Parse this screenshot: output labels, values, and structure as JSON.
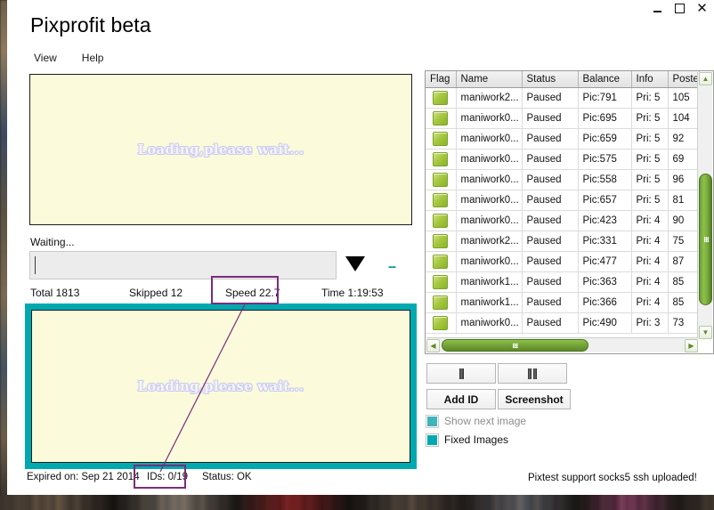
{
  "window": {
    "title": "Pixprofit beta",
    "controls": {
      "minimize": "–",
      "maximize": "□",
      "close": "✕"
    }
  },
  "menu": {
    "items": [
      {
        "label": "View"
      },
      {
        "label": "Help"
      }
    ]
  },
  "image_panels": {
    "primary": {
      "loading_text": "Loading,please wait..."
    },
    "secondary": {
      "loading_text": "Loading,please wait...",
      "border_color": "#00a9b0"
    }
  },
  "progress": {
    "status_label": "Waiting...",
    "value": "",
    "dropdown_icon": "triangle-down-icon",
    "dashes": "--"
  },
  "stats": {
    "total": "Total 1813",
    "skipped": "Skipped 12",
    "speed": "Speed 22.7",
    "time": "Time 1:19:53"
  },
  "bottom_status": {
    "expired": "Expired on: Sep 21 2014",
    "ids": "IDs: 0/19",
    "status": "Status: OK",
    "footer_note": "Pixtest support socks5  ssh uploaded!"
  },
  "annotations": {
    "color": "#7b2d7b",
    "highlight_speed": "Speed 22.7",
    "highlight_ids": "IDs: 0/19"
  },
  "table": {
    "columns": [
      "Flag",
      "Name",
      "Status",
      "Balance",
      "Info",
      "Poste"
    ],
    "rows": [
      {
        "flag": "flag-icon",
        "name": "maniwork2...",
        "status": "Paused",
        "balance": "Pic:791",
        "info": "Pri: 5",
        "posted": "105"
      },
      {
        "flag": "flag-icon",
        "name": "maniwork0...",
        "status": "Paused",
        "balance": "Pic:695",
        "info": "Pri: 5",
        "posted": "104"
      },
      {
        "flag": "flag-icon",
        "name": "maniwork0...",
        "status": "Paused",
        "balance": "Pic:659",
        "info": "Pri: 5",
        "posted": "92"
      },
      {
        "flag": "flag-icon",
        "name": "maniwork0...",
        "status": "Paused",
        "balance": "Pic:575",
        "info": "Pri: 5",
        "posted": "69"
      },
      {
        "flag": "flag-icon",
        "name": "maniwork0...",
        "status": "Paused",
        "balance": "Pic:558",
        "info": "Pri: 5",
        "posted": "96"
      },
      {
        "flag": "flag-icon",
        "name": "maniwork0...",
        "status": "Paused",
        "balance": "Pic:657",
        "info": "Pri: 5",
        "posted": "81"
      },
      {
        "flag": "flag-icon",
        "name": "maniwork0...",
        "status": "Paused",
        "balance": "Pic:423",
        "info": "Pri: 4",
        "posted": "90"
      },
      {
        "flag": "flag-icon",
        "name": "maniwork2...",
        "status": "Paused",
        "balance": "Pic:331",
        "info": "Pri: 4",
        "posted": "75"
      },
      {
        "flag": "flag-icon",
        "name": "maniwork0...",
        "status": "Paused",
        "balance": "Pic:477",
        "info": "Pri: 4",
        "posted": "87"
      },
      {
        "flag": "flag-icon",
        "name": "maniwork1...",
        "status": "Paused",
        "balance": "Pic:363",
        "info": "Pri: 4",
        "posted": "85"
      },
      {
        "flag": "flag-icon",
        "name": "maniwork1...",
        "status": "Paused",
        "balance": "Pic:366",
        "info": "Pri: 4",
        "posted": "85"
      },
      {
        "flag": "flag-icon",
        "name": "maniwork0...",
        "status": "Paused",
        "balance": "Pic:490",
        "info": "Pri: 3",
        "posted": "73"
      }
    ],
    "scroll": {
      "up_arrow": "▲",
      "down_arrow": "▼",
      "left_arrow": "◀",
      "right_arrow": "▶"
    }
  },
  "controls": {
    "start_icon": "single-bar-icon",
    "pause_icon": "double-bar-icon",
    "add_id_label": "Add ID",
    "screenshot_label": "Screenshot",
    "show_next_image_label": "Show next image",
    "fixed_images_label": "Fixed Images",
    "checkbox_color": "#00a9b0"
  }
}
